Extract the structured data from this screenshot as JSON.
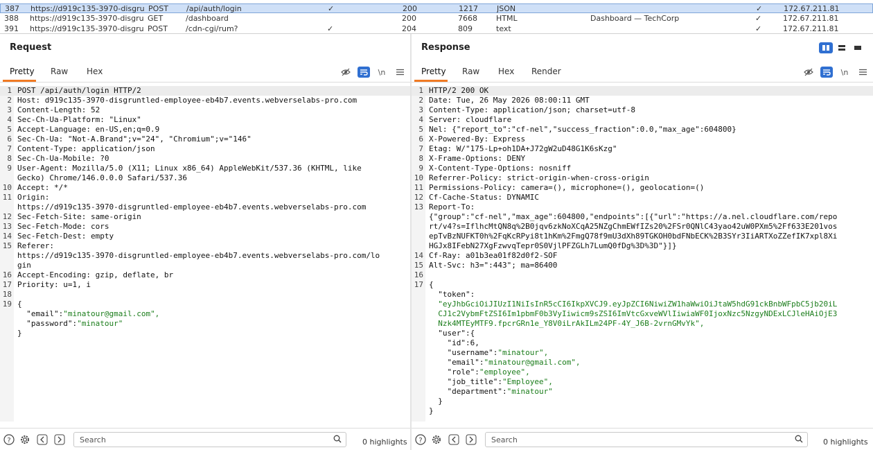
{
  "history": [
    {
      "num": "387",
      "host": "https://d919c135-3970-disgrun...",
      "method": "POST",
      "url": "/api/auth/login",
      "params": "✓",
      "status": "200",
      "length": "1217",
      "mime": "JSON",
      "title": "",
      "tls": "✓",
      "ip": "172.67.211.81",
      "selected": true
    },
    {
      "num": "388",
      "host": "https://d919c135-3970-disgrun...",
      "method": "GET",
      "url": "/dashboard",
      "params": "",
      "status": "200",
      "length": "7668",
      "mime": "HTML",
      "title": "Dashboard — TechCorp ...",
      "tls": "✓",
      "ip": "172.67.211.81",
      "selected": false
    },
    {
      "num": "391",
      "host": "https://d919c135-3970-disgrun...",
      "method": "POST",
      "url": "/cdn-cgi/rum?",
      "params": "✓",
      "status": "204",
      "length": "809",
      "mime": "text",
      "title": "",
      "tls": "✓",
      "ip": "172.67.211.81",
      "selected": false
    }
  ],
  "request": {
    "title": "Request",
    "tabs": [
      "Pretty",
      "Raw",
      "Hex"
    ],
    "active_tab": "Pretty",
    "lines": [
      {
        "n": "1",
        "t": "POST /api/auth/login HTTP/2"
      },
      {
        "n": "2",
        "t": "Host: d919c135-3970-disgruntled-employee-eb4b7.events.webverselabs-pro.com"
      },
      {
        "n": "3",
        "t": "Content-Length: 52"
      },
      {
        "n": "4",
        "t": "Sec-Ch-Ua-Platform: \"Linux\""
      },
      {
        "n": "5",
        "t": "Accept-Language: en-US,en;q=0.9"
      },
      {
        "n": "6",
        "t": "Sec-Ch-Ua: \"Not-A.Brand\";v=\"24\", \"Chromium\";v=\"146\""
      },
      {
        "n": "7",
        "t": "Content-Type: application/json"
      },
      {
        "n": "8",
        "t": "Sec-Ch-Ua-Mobile: ?0"
      },
      {
        "n": "9",
        "t": "User-Agent: Mozilla/5.0 (X11; Linux x86_64) AppleWebKit/537.36 (KHTML, like"
      },
      {
        "n": "",
        "t": "Gecko) Chrome/146.0.0.0 Safari/537.36"
      },
      {
        "n": "10",
        "t": "Accept: */*"
      },
      {
        "n": "11",
        "t": "Origin:"
      },
      {
        "n": "",
        "t": "https://d919c135-3970-disgruntled-employee-eb4b7.events.webverselabs-pro.com"
      },
      {
        "n": "12",
        "t": "Sec-Fetch-Site: same-origin"
      },
      {
        "n": "13",
        "t": "Sec-Fetch-Mode: cors"
      },
      {
        "n": "14",
        "t": "Sec-Fetch-Dest: empty"
      },
      {
        "n": "15",
        "t": "Referer:"
      },
      {
        "n": "",
        "t": "https://d919c135-3970-disgruntled-employee-eb4b7.events.webverselabs-pro.com/lo"
      },
      {
        "n": "",
        "t": "gin"
      },
      {
        "n": "16",
        "t": "Accept-Encoding: gzip, deflate, br"
      },
      {
        "n": "17",
        "t": "Priority: u=1, i"
      },
      {
        "n": "18",
        "t": ""
      },
      {
        "n": "19",
        "t": "{"
      },
      {
        "n": "",
        "t": "  \"email\":\"minatour@gmail.com\",",
        "json": true
      },
      {
        "n": "",
        "t": "  \"password\":\"minatour\"",
        "json": true
      },
      {
        "n": "",
        "t": "}"
      }
    ],
    "search_placeholder": "Search",
    "highlights": "0 highlights"
  },
  "response": {
    "title": "Response",
    "tabs": [
      "Pretty",
      "Raw",
      "Hex",
      "Render"
    ],
    "active_tab": "Pretty",
    "lines": [
      {
        "n": "1",
        "t": "HTTP/2 200 OK"
      },
      {
        "n": "2",
        "t": "Date: Tue, 26 May 2026 08:00:11 GMT"
      },
      {
        "n": "3",
        "t": "Content-Type: application/json; charset=utf-8"
      },
      {
        "n": "4",
        "t": "Server: cloudflare"
      },
      {
        "n": "5",
        "t": "Nel: {\"report_to\":\"cf-nel\",\"success_fraction\":0.0,\"max_age\":604800}"
      },
      {
        "n": "6",
        "t": "X-Powered-By: Express"
      },
      {
        "n": "7",
        "t": "Etag: W/\"175-Lp+oh1DA+J72gW2uD48G1K6sKzg\""
      },
      {
        "n": "8",
        "t": "X-Frame-Options: DENY"
      },
      {
        "n": "9",
        "t": "X-Content-Type-Options: nosniff"
      },
      {
        "n": "10",
        "t": "Referrer-Policy: strict-origin-when-cross-origin"
      },
      {
        "n": "11",
        "t": "Permissions-Policy: camera=(), microphone=(), geolocation=()"
      },
      {
        "n": "12",
        "t": "Cf-Cache-Status: DYNAMIC"
      },
      {
        "n": "13",
        "t": "Report-To:"
      },
      {
        "n": "",
        "t": "{\"group\":\"cf-nel\",\"max_age\":604800,\"endpoints\":[{\"url\":\"https://a.nel.cloudflare.com/repo"
      },
      {
        "n": "",
        "t": "rt/v4?s=IflhcMtQN8q%2B0jqv6zkNoXCqA25NZgChmEWfIZs20%2FSr0QNlC43yao42uW0PXm5%2Ff633E201vos"
      },
      {
        "n": "",
        "t": "epTvBzNUFKT0h%2FqKcRPyi8t1hKm%2FmgQ78f9mU3dXh89TGKOH0bdFNbECK%2B3SYr3IiARTXoZZefIK7xpl8Xi"
      },
      {
        "n": "",
        "t": "HGJx8IFebN27XgFzwvqTepr0S0VjlPFZGLh7LumQ0fDg%3D%3D\"}]}"
      },
      {
        "n": "14",
        "t": "Cf-Ray: a01b3ea01f82d0f2-SOF"
      },
      {
        "n": "15",
        "t": "Alt-Svc: h3=\":443\"; ma=86400"
      },
      {
        "n": "16",
        "t": ""
      },
      {
        "n": "17",
        "t": "{"
      },
      {
        "n": "",
        "t": "  \"token\":",
        "json": true
      },
      {
        "n": "",
        "t": "  \"eyJhbGciOiJIUzI1NiIsInR5cCI6IkpXVCJ9.eyJpZCI6NiwiZW1haWwiOiJtaW5hdG91ckBnbWFpbC5jb20iL",
        "json": true,
        "str": true
      },
      {
        "n": "",
        "t": "  CJ1c2VybmFtZSI6Im1pbmF0b3VyIiwicm9sZSI6ImVtcGxveWVlIiwiaWF0IjoxNzc5NzgyNDExLCJleHAiOjE3",
        "json": true,
        "str": true
      },
      {
        "n": "",
        "t": "  Nzk4MTEyMTF9.fpcrGRn1e_Y8V0iLrAkILm24PF-4Y_J6B-2vrnGMvYk\",",
        "json": true,
        "str": true
      },
      {
        "n": "",
        "t": "  \"user\":{",
        "json": true
      },
      {
        "n": "",
        "t": "    \"id\":6,",
        "json": true
      },
      {
        "n": "",
        "t": "    \"username\":\"minatour\",",
        "json": true
      },
      {
        "n": "",
        "t": "    \"email\":\"minatour@gmail.com\",",
        "json": true
      },
      {
        "n": "",
        "t": "    \"role\":\"employee\",",
        "json": true
      },
      {
        "n": "",
        "t": "    \"job_title\":\"Employee\",",
        "json": true
      },
      {
        "n": "",
        "t": "    \"department\":\"minatour\"",
        "json": true
      },
      {
        "n": "",
        "t": "  }"
      },
      {
        "n": "",
        "t": "}"
      }
    ],
    "search_placeholder": "Search",
    "highlights": "0 highlights"
  },
  "colors": {
    "accent": "#2f6fd1",
    "tab_underline": "#f07a24",
    "json_string": "#1b7d1b",
    "selected_row": "#cfe0f7"
  },
  "icons": {
    "hide": "eye-slash-icon",
    "wrap": "word-wrap-icon",
    "newline": "newline-icon",
    "menu": "hamburger-menu-icon",
    "help": "help-icon",
    "settings": "gear-icon",
    "back": "arrow-left-icon",
    "forward": "arrow-right-icon",
    "search": "search-icon"
  }
}
